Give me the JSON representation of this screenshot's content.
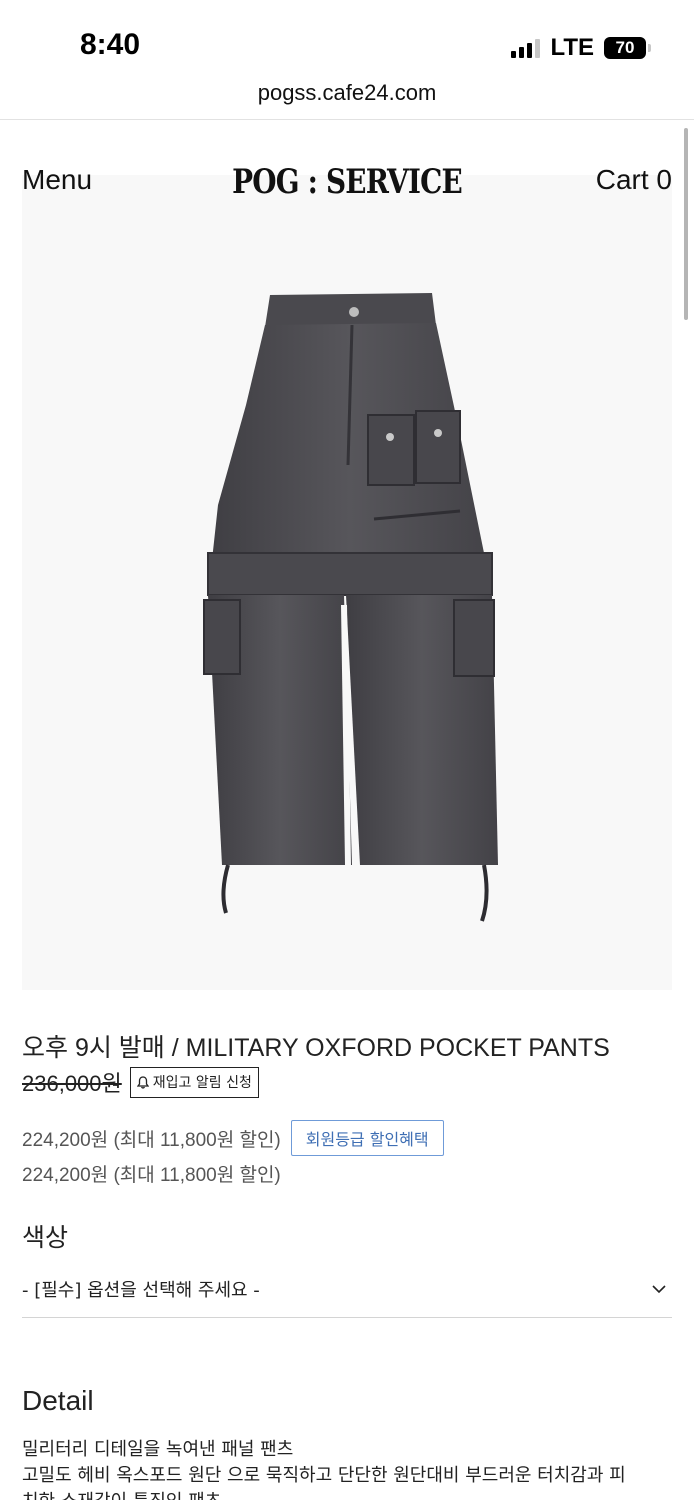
{
  "status_bar": {
    "time": "8:40",
    "network": "LTE",
    "battery": "70",
    "signal_icon": "cellular-signal-icon"
  },
  "browser": {
    "url": "pogss.cafe24.com"
  },
  "header": {
    "menu_label": "Menu",
    "logo_text": "POG : SERVICE",
    "cart_label": "Cart 0"
  },
  "product": {
    "image_alt": "dark grey military cargo pants",
    "title": "오후 9시 발매 / MILITARY OXFORD POCKET PANTS",
    "original_price": "236,000원",
    "restock_button": "재입고 알림 신청",
    "sale_price_text": "224,200원 (최대 11,800원 할인)",
    "member_discount_button": "회원등급 할인혜택",
    "sale_price_text_2": "224,200원 (최대 11,800원 할인)",
    "colors": {
      "member_button_border": "#6f9bd8",
      "member_button_text": "#3f6fb4",
      "pants": "#4d4c51"
    }
  },
  "options": {
    "color_label": "색상",
    "select_placeholder": "- [필수] 옵션을 선택해 주세요 -",
    "chevron_icon": "chevron-down-icon"
  },
  "detail": {
    "title": "Detail",
    "lines": [
      "밀리터리 디테일을 녹여낸 패널 팬츠",
      "고밀도 헤비 옥스포드 원단 으로 묵직하고 단단한 원단대비 부드러운 터치감과 피",
      "치한 소재감이 특징인 팬츠"
    ]
  }
}
